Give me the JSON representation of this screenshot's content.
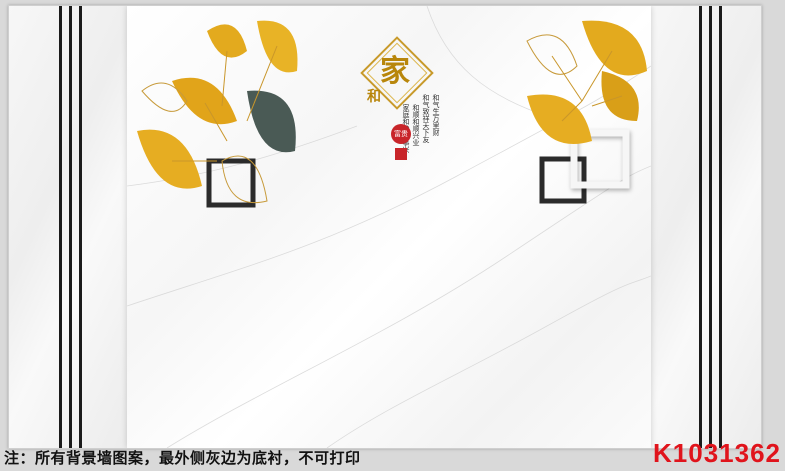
{
  "design": {
    "emblem_char": "家",
    "emblem_sub": "和",
    "poem_lines": [
      "和气致祥天下友",
      "和气生万里财",
      "和顺和顺兴业",
      "家庭和睦万事兴"
    ],
    "seal_top": "富贵",
    "seal_bottom": "",
    "footer_note": "注：所有背景墙图案，最外侧灰边为底衬，不可打印",
    "product_code": "K1031362",
    "colors": {
      "gold": "#e0a81c",
      "code_red": "#e0141c",
      "frame_dark": "#1b1b1b"
    }
  }
}
